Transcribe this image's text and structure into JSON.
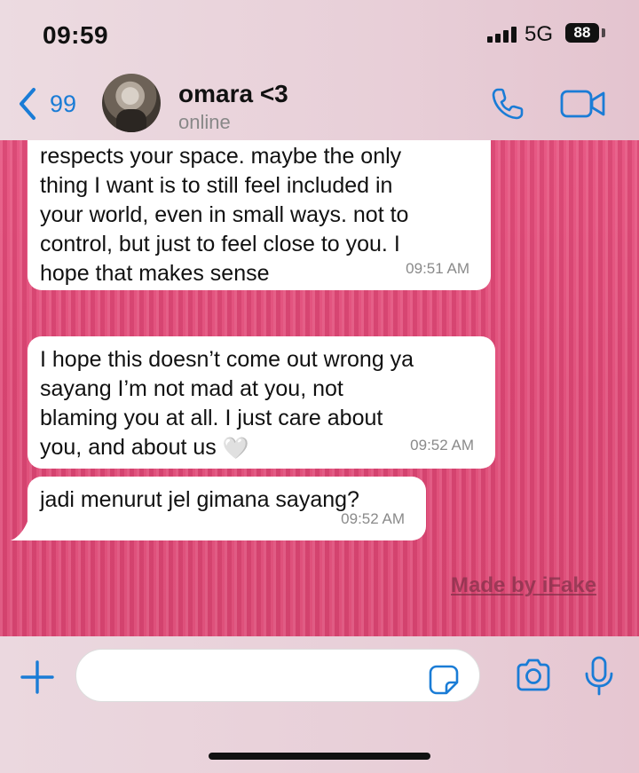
{
  "status_bar": {
    "time": "09:59",
    "network": "5G",
    "battery": "88"
  },
  "header": {
    "back_count": "99",
    "contact_name": "omara <3",
    "contact_status": "online"
  },
  "messages": [
    {
      "text": "about what I feel, in a way that still\nrespects your space. maybe the only\nthing I want is to still feel included in\nyour world, even in small ways. not to\ncontrol, but just to feel close to you. I\nhope that makes sense",
      "time": "09:51 AM"
    },
    {
      "text": "I hope this doesn’t come out wrong ya\nsayang I’m not mad at you, not\nblaming you at all. I just care about\nyou, and about us ",
      "emoji": "🤍",
      "time": "09:52 AM"
    },
    {
      "text": "jadi menurut jel gimana sayang?",
      "time": "09:52 AM"
    }
  ],
  "watermark": "Made by iFake",
  "input": {
    "placeholder": ""
  },
  "colors": {
    "accent": "#1a7cd6",
    "chat_background": "#e04b78",
    "bubble": "#ffffff"
  }
}
